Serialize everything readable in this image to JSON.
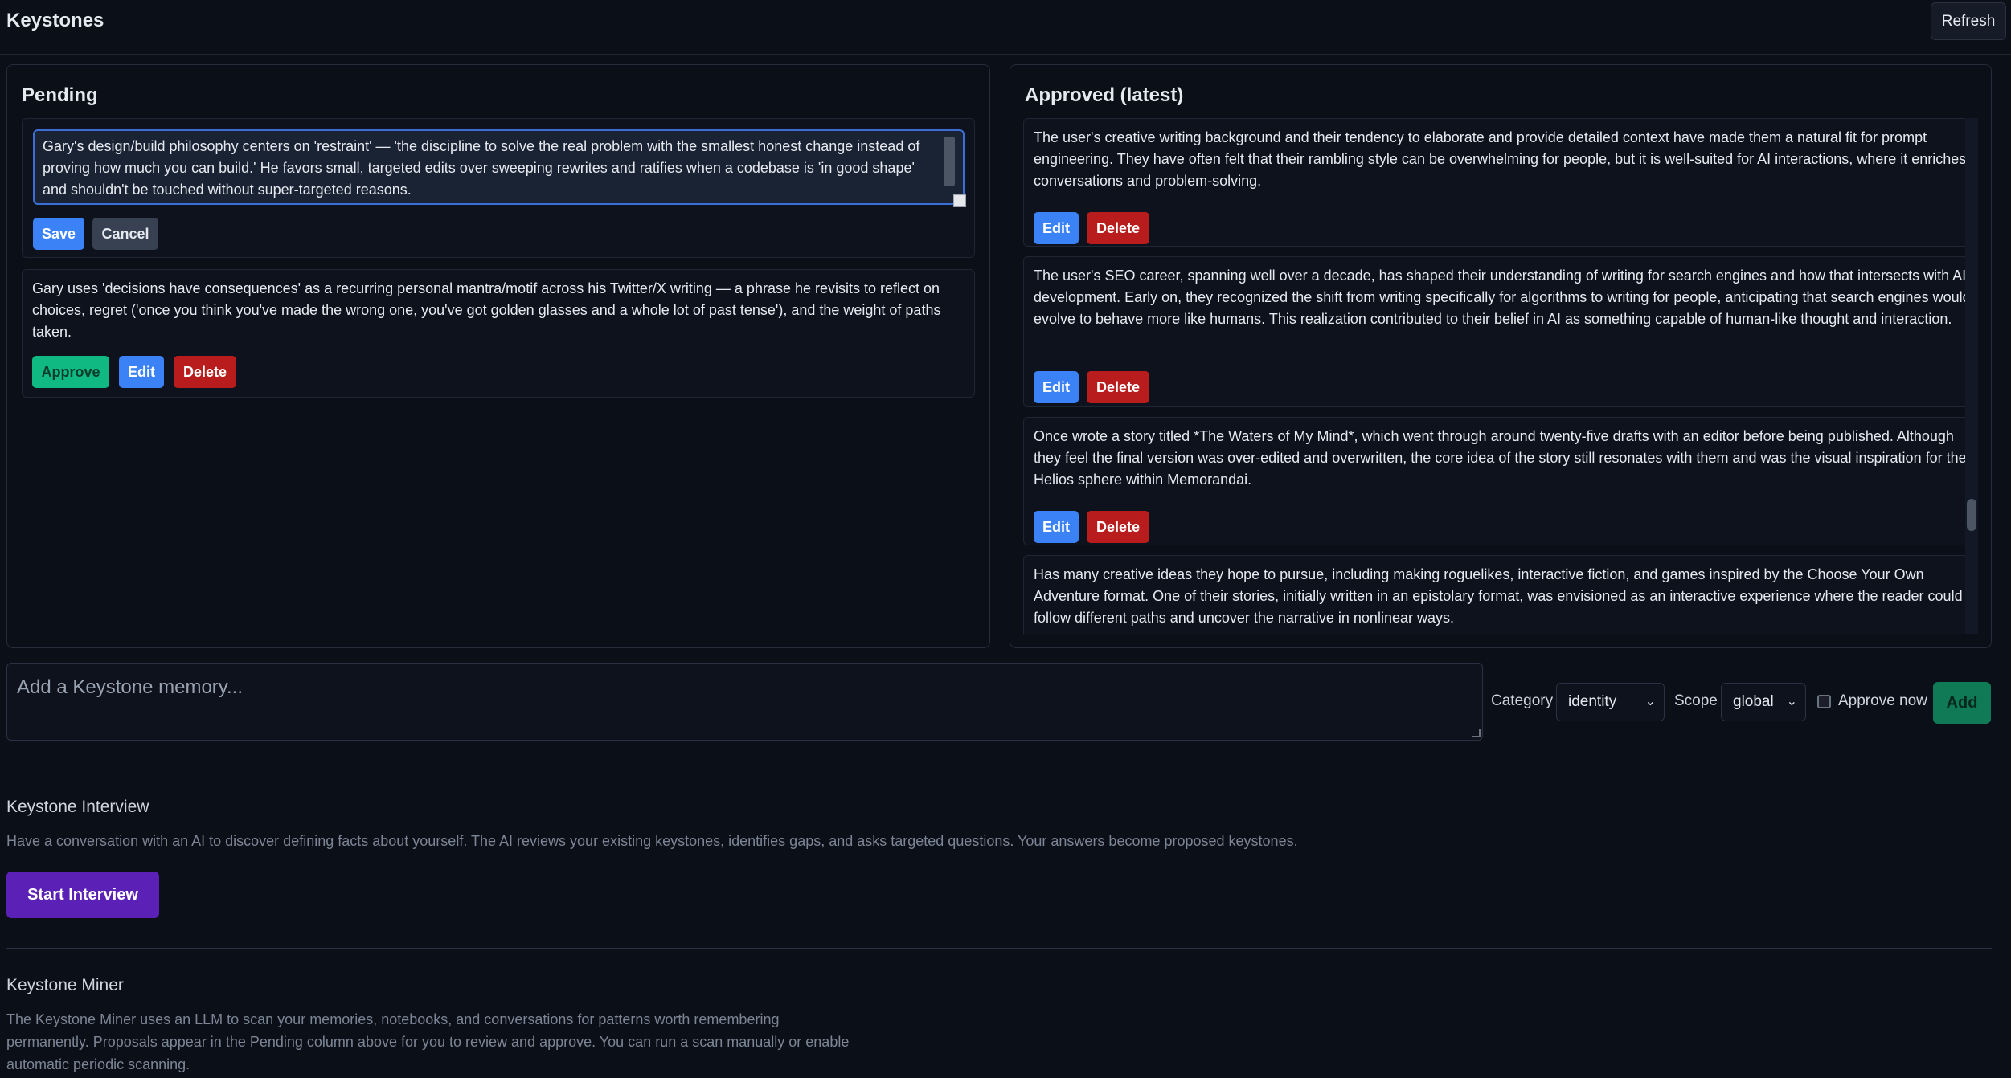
{
  "header": {
    "title": "Keystones",
    "refresh_label": "Refresh"
  },
  "pending": {
    "title": "Pending",
    "editing_text": "Gary's design/build philosophy centers on 'restraint' — 'the discipline to solve the real problem with the smallest honest change instead of proving how much you can build.' He favors small, targeted edits over sweeping rewrites and ratifies when a codebase is 'in good shape' and shouldn't be touched without super-targeted reasons.",
    "save_label": "Save",
    "cancel_label": "Cancel",
    "items": [
      {
        "text": "Gary uses 'decisions have consequences' as a recurring personal mantra/motif across his Twitter/X writing — a phrase he revisits to reflect on choices, regret ('once you think you've made the wrong one, you've got golden glasses and a whole lot of past tense'), and the weight of paths taken.",
        "approve_label": "Approve",
        "edit_label": "Edit",
        "delete_label": "Delete"
      }
    ]
  },
  "approved": {
    "title": "Approved (latest)",
    "items": [
      {
        "text": "The user's creative writing background and their tendency to elaborate and provide detailed context have made them a natural fit for prompt engineering. They have often felt that their rambling style can be overwhelming for people, but it is well-suited for AI interactions, where it enriches conversations and problem-solving.",
        "edit_label": "Edit",
        "delete_label": "Delete"
      },
      {
        "text": "The user's SEO career, spanning well over a decade, has shaped their understanding of writing for search engines and how that intersects with AI development. Early on, they recognized the shift from writing specifically for algorithms to writing for people, anticipating that search engines would evolve to behave more like humans. This realization contributed to their belief in AI as something capable of human-like thought and interaction.",
        "edit_label": "Edit",
        "delete_label": "Delete"
      },
      {
        "text": "Once wrote a story titled *The Waters of My Mind*, which went through around twenty-five drafts with an editor before being published. Although they feel the final version was over-edited and overwritten, the core idea of the story still resonates with them and was the visual inspiration for the Helios sphere within Memorandai.",
        "edit_label": "Edit",
        "delete_label": "Delete"
      },
      {
        "text": "Has many creative ideas they hope to pursue, including making roguelikes, interactive fiction, and games inspired by the Choose Your Own Adventure format. One of their stories, initially written in an epistolary format, was envisioned as an interactive experience where the reader could follow different paths and uncover the narrative in nonlinear ways."
      }
    ]
  },
  "add_form": {
    "placeholder": "Add a Keystone memory...",
    "category_label": "Category",
    "category_value": "identity",
    "scope_label": "Scope",
    "scope_value": "global",
    "approve_now_label": "Approve now",
    "approve_now_checked": false,
    "add_label": "Add"
  },
  "interview": {
    "title": "Keystone Interview",
    "description": "Have a conversation with an AI to discover defining facts about yourself. The AI reviews your existing keystones, identifies gaps, and asks targeted questions. Your answers become proposed keystones.",
    "button_label": "Start Interview"
  },
  "miner": {
    "title": "Keystone Miner",
    "description_lines": [
      "The Keystone Miner uses an LLM to scan your memories, notebooks, and conversations for patterns worth remembering",
      "permanently. Proposals appear in the Pending column above for you to review and approve. You can run a scan manually or enable",
      "automatic periodic scanning."
    ]
  },
  "colors": {
    "background": "#0b0f17",
    "primary_blue": "#3b82f6",
    "danger_red": "#b91c1c",
    "approve_green": "#10b981",
    "interview_purple": "#5b21b6"
  }
}
